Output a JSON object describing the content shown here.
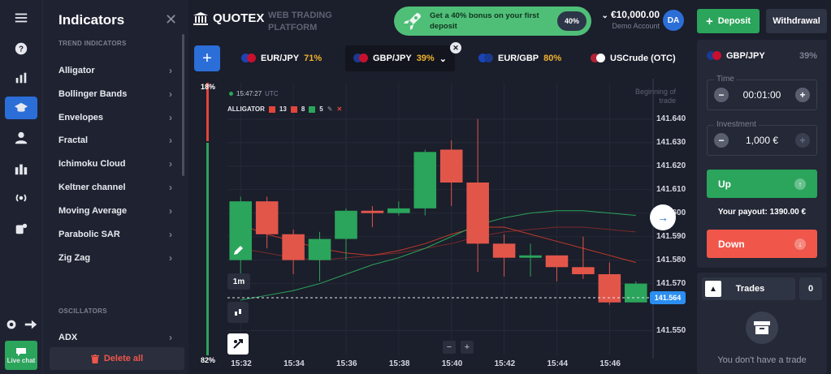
{
  "rail": {
    "menu": "menu-icon",
    "items": [
      "help-icon",
      "chart-bars-icon",
      "education-icon",
      "profile-icon",
      "market-icon",
      "signals-icon",
      "achievements-icon"
    ],
    "settings": "settings-icon",
    "logout": "logout-icon",
    "livechat_label": "Live chat"
  },
  "indicators": {
    "title": "Indicators",
    "section_trend": "TREND INDICATORS",
    "items": [
      "Alligator",
      "Bollinger Bands",
      "Envelopes",
      "Fractal",
      "Ichimoku Cloud",
      "Keltner channel",
      "Moving Average",
      "Parabolic SAR",
      "Zig Zag"
    ],
    "section_osc": "OSCILLATORS",
    "osc_items": [
      "ADX"
    ],
    "delete_label": "Delete all"
  },
  "header": {
    "logo": "QUOTEX",
    "subtitle": "WEB TRADING PLATFORM",
    "bonus_text": "Get a 40% bonus on your first deposit",
    "bonus_pct": "40%",
    "balance": "€10,000.00",
    "balance_label": "Demo Account",
    "avatar": "DA",
    "deposit_label": "Deposit",
    "withdrawal_label": "Withdrawal"
  },
  "tabs": [
    {
      "label": "EUR/JPY",
      "pct": "71%",
      "flag": [
        "#1a44b8",
        "#c8102e"
      ]
    },
    {
      "label": "GBP/JPY",
      "pct": "39%",
      "flag": [
        "#1a3a8f",
        "#c8102e"
      ]
    },
    {
      "label": "EUR/GBP",
      "pct": "80%",
      "flag": [
        "#1a44b8",
        "#1a3a8f"
      ]
    },
    {
      "label": "USCrude (OTC)",
      "pct": "",
      "flag": [
        "#b22234",
        "#ffffff"
      ]
    }
  ],
  "chart": {
    "time": "15:47:27",
    "tz": "UTC",
    "indicator_name": "ALLIGATOR",
    "alligator_params": [
      "13",
      "8",
      "5"
    ],
    "alligator_colors": [
      "#e2453a",
      "#e2453a",
      "#2aa55b"
    ],
    "begin_label": "Beginning of trade",
    "pct_top": "18%",
    "pct_bot": "82%",
    "timeframe": "1m",
    "current_price": "141.564"
  },
  "chart_data": {
    "type": "candlestick",
    "y_ticks": [
      "141.640",
      "141.630",
      "141.620",
      "141.610",
      "141.600",
      "141.590",
      "141.580",
      "141.570",
      "141.550"
    ],
    "x_ticks": [
      "15:32",
      "15:34",
      "15:36",
      "15:38",
      "15:40",
      "15:42",
      "15:44",
      "15:46"
    ],
    "ylim": [
      141.545,
      141.652
    ],
    "candles": [
      {
        "t": "15:32",
        "o": 141.58,
        "c": 141.605,
        "h": 141.607,
        "l": 141.572
      },
      {
        "t": "15:33",
        "o": 141.605,
        "c": 141.591,
        "h": 141.607,
        "l": 141.585
      },
      {
        "t": "15:34",
        "o": 141.591,
        "c": 141.58,
        "h": 141.593,
        "l": 141.574
      },
      {
        "t": "15:35",
        "o": 141.58,
        "c": 141.589,
        "h": 141.592,
        "l": 141.571
      },
      {
        "t": "15:36",
        "o": 141.589,
        "c": 141.601,
        "h": 141.602,
        "l": 141.58
      },
      {
        "t": "15:37",
        "o": 141.601,
        "c": 141.6,
        "h": 141.603,
        "l": 141.594
      },
      {
        "t": "15:38",
        "o": 141.6,
        "c": 141.602,
        "h": 141.605,
        "l": 141.599
      },
      {
        "t": "15:39",
        "o": 141.602,
        "c": 141.626,
        "h": 141.627,
        "l": 141.599
      },
      {
        "t": "15:40",
        "o": 141.627,
        "c": 141.613,
        "h": 141.631,
        "l": 141.603
      },
      {
        "t": "15:41",
        "o": 141.613,
        "c": 141.587,
        "h": 141.64,
        "l": 141.575
      },
      {
        "t": "15:42",
        "o": 141.587,
        "c": 141.581,
        "h": 141.591,
        "l": 141.573
      },
      {
        "t": "15:43",
        "o": 141.581,
        "c": 141.582,
        "h": 141.587,
        "l": 141.573
      },
      {
        "t": "15:44",
        "o": 141.582,
        "c": 141.577,
        "h": 141.582,
        "l": 141.571
      },
      {
        "t": "15:45",
        "o": 141.577,
        "c": 141.574,
        "h": 141.59,
        "l": 141.572
      },
      {
        "t": "15:46",
        "o": 141.574,
        "c": 141.562,
        "h": 141.579,
        "l": 141.561
      },
      {
        "t": "15:47",
        "o": 141.562,
        "c": 141.57,
        "h": 141.571,
        "l": 141.562
      }
    ],
    "alligator_lines": [
      {
        "color": "#7a2a2a",
        "values": [
          141.585,
          141.583,
          141.581,
          141.58,
          141.581,
          141.582,
          141.583,
          141.585,
          141.587,
          141.59,
          141.592,
          141.593,
          141.594,
          141.594,
          141.593,
          141.592
        ]
      },
      {
        "color": "#c0392b",
        "values": [
          141.595,
          141.591,
          141.588,
          141.585,
          141.583,
          141.582,
          141.584,
          141.587,
          141.591,
          141.594,
          141.594,
          141.591,
          141.588,
          141.585,
          141.582,
          141.579
        ]
      },
      {
        "color": "#2aa55b",
        "values": [
          141.563,
          141.565,
          141.567,
          141.57,
          141.574,
          141.578,
          141.581,
          141.585,
          141.59,
          141.595,
          141.598,
          141.6,
          141.601,
          141.601,
          141.6,
          141.599
        ]
      }
    ]
  },
  "trade": {
    "asset": "GBP/JPY",
    "pct": "39%",
    "time_label": "Time",
    "time_value": "00:01:00",
    "invest_label": "Investment",
    "invest_value": "1,000 €",
    "up_label": "Up",
    "payout": "Your payout: 1390.00 €",
    "down_label": "Down"
  },
  "trades": {
    "label": "Trades",
    "count": "0",
    "empty": "You don't have a trade"
  }
}
